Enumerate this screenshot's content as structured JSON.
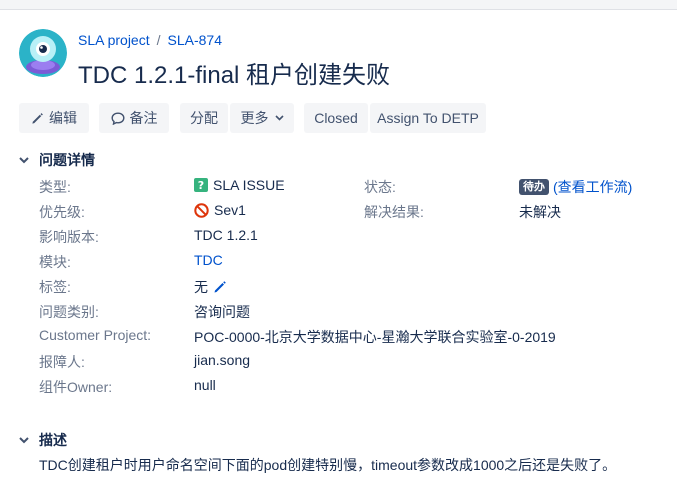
{
  "breadcrumb": {
    "project": "SLA project",
    "separator": "/",
    "issue_key": "SLA-874"
  },
  "issue": {
    "title": "TDC 1.2.1-final 租户创建失败"
  },
  "toolbar": {
    "edit": "编辑",
    "comment": "备注",
    "assign": "分配",
    "more": "更多",
    "closed": "Closed",
    "assign_detp": "Assign To DETP"
  },
  "details": {
    "heading": "问题详情",
    "left": [
      {
        "label": "类型:",
        "value": "SLA ISSUE",
        "icon": "question-icon"
      },
      {
        "label": "优先级:",
        "value": "Sev1",
        "icon": "no-entry-icon"
      },
      {
        "label": "影响版本:",
        "value": "TDC 1.2.1"
      },
      {
        "label": "模块:",
        "value": "TDC"
      },
      {
        "label": "标签:",
        "value": "无",
        "icon": "pencil-icon"
      },
      {
        "label": "问题类别:",
        "value": "咨询问题"
      },
      {
        "label": "Customer Project:",
        "value": "POC-0000-北京大学数据中心-星瀚大学联合实验室-0-2019"
      },
      {
        "label": "报障人:",
        "value": "jian.song"
      },
      {
        "label": "组件Owner:",
        "value": "null"
      }
    ],
    "status_label": "状态:",
    "status_badge": "待办",
    "status_link": "(查看工作流)",
    "resolution_label": "解决结果:",
    "resolution_value": "未解决"
  },
  "description": {
    "heading": "描述",
    "text": "TDC创建租户时用户命名空间下面的pod创建特别慢，timeout参数改成1000之后还是失败了。"
  },
  "colors": {
    "link": "#0052cc",
    "button_bg": "#f4f5f7",
    "badge_bg": "#42526e",
    "text": "#172b4d",
    "muted": "#6b778c"
  }
}
